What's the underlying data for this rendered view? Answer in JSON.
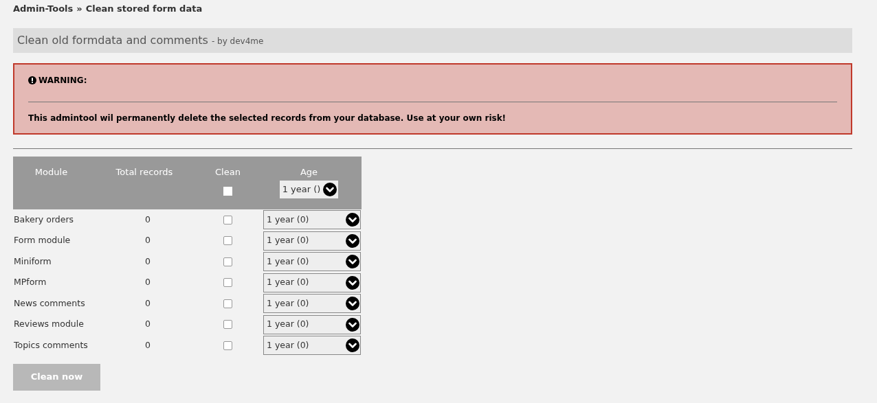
{
  "breadcrumb": {
    "parent": "Admin-Tools",
    "separator": "»",
    "current": "Clean stored form data"
  },
  "panel": {
    "title": "Clean old formdata and comments",
    "byline": "- by dev4me"
  },
  "warning": {
    "title": "WARNING:",
    "message": "This admintool wil permanently delete the selected records from your database. Use at your own risk!"
  },
  "table": {
    "columns": [
      "Module",
      "Total records",
      "Clean",
      "Age"
    ],
    "header_checkbox": {
      "checked": false
    },
    "header_select": "1 year ()",
    "rows": [
      {
        "module": "Bakery orders",
        "total": "0",
        "checked": false,
        "age": "1 year (0)"
      },
      {
        "module": "Form module",
        "total": "0",
        "checked": false,
        "age": "1 year (0)"
      },
      {
        "module": "Miniform",
        "total": "0",
        "checked": false,
        "age": "1 year (0)"
      },
      {
        "module": "MPform",
        "total": "0",
        "checked": false,
        "age": "1 year (0)"
      },
      {
        "module": "News comments",
        "total": "0",
        "checked": false,
        "age": "1 year (0)"
      },
      {
        "module": "Reviews module",
        "total": "0",
        "checked": false,
        "age": "1 year (0)"
      },
      {
        "module": "Topics comments",
        "total": "0",
        "checked": false,
        "age": "1 year (0)"
      }
    ]
  },
  "button": {
    "label": "Clean now",
    "disabled": true
  }
}
